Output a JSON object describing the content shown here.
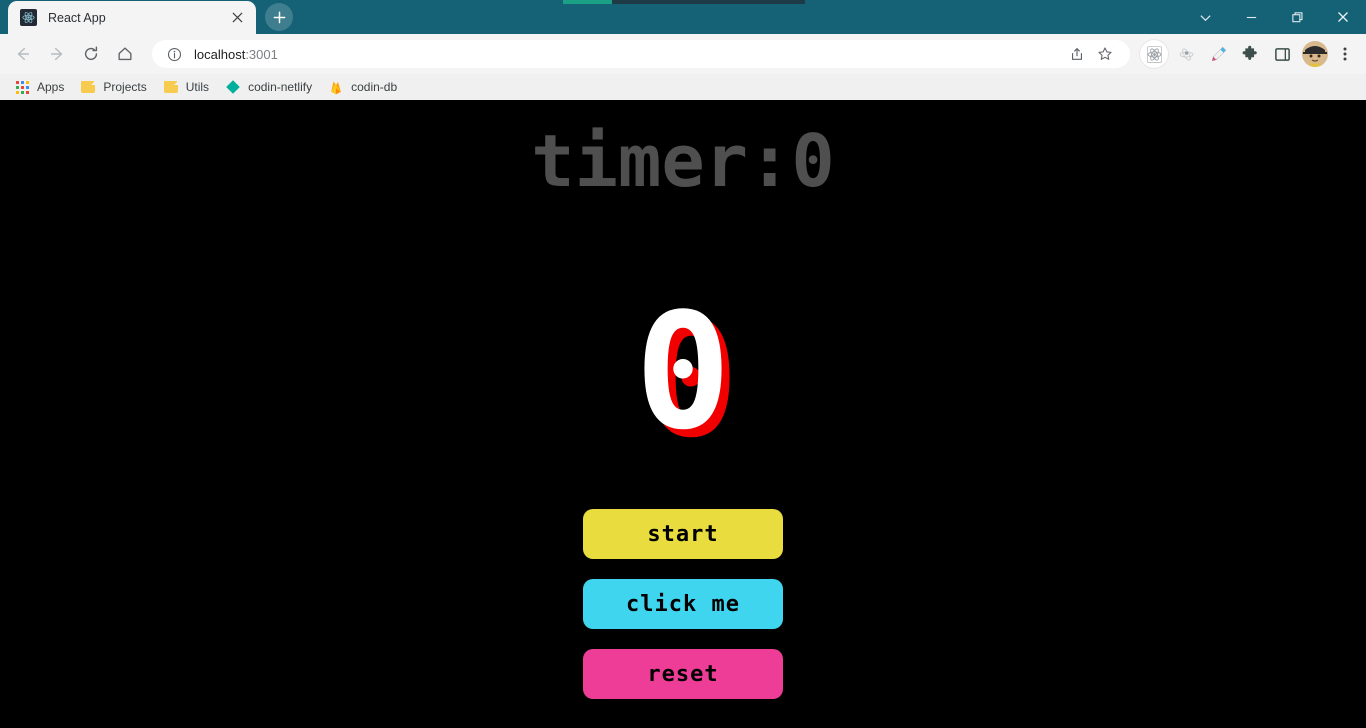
{
  "window": {
    "controls": [
      {
        "name": "chevron-down",
        "glyph": "⌄"
      },
      {
        "name": "minimize",
        "glyph": "—"
      },
      {
        "name": "restore",
        "glyph": "❐"
      },
      {
        "name": "close",
        "glyph": "✕"
      }
    ],
    "titlebar_color": "#156277",
    "strips": [
      {
        "color": "#1aa085"
      },
      {
        "color": "#1e3a46"
      }
    ]
  },
  "tab": {
    "title": "React App",
    "favicon": "react-logo-icon",
    "close_glyph": "✕",
    "new_tab_glyph": "+"
  },
  "toolbar": {
    "back": "←",
    "forward": "→",
    "reload": "↻",
    "home": "⌂",
    "url_main": "localhost",
    "url_port": ":3001",
    "url_full": "localhost:3001",
    "info_glyph": "ⓘ",
    "share_glyph": "↱",
    "bookmark_glyph": "☆",
    "pen_glyph": "✎",
    "puzzle_glyph": "❖",
    "panel_glyph": "□",
    "menu_glyph": "⋮"
  },
  "bookmarks": [
    {
      "label": "Apps",
      "icon": "apps-grid-icon"
    },
    {
      "label": "Projects",
      "icon": "folder-icon"
    },
    {
      "label": "Utils",
      "icon": "folder-icon"
    },
    {
      "label": "codin-netlify",
      "icon": "netlify-diamond-icon",
      "color": "#00b09b"
    },
    {
      "label": "codin-db",
      "icon": "firebase-flame-icon",
      "color": "#ffa000"
    }
  ],
  "page": {
    "background": "#000000",
    "heading": "timer:0",
    "heading_color": "#4f4f4f",
    "logo_char": "0",
    "logo_front_color": "#ffffff",
    "logo_shadow_color": "#f20000",
    "buttons": [
      {
        "label": "start",
        "bg": "#e8dc3f",
        "text_color": "#000000"
      },
      {
        "label": "click me",
        "bg": "#3fd5ef",
        "text_color": "#000000"
      },
      {
        "label": "reset",
        "bg": "#ee3d96",
        "text_color": "#000000"
      }
    ]
  }
}
